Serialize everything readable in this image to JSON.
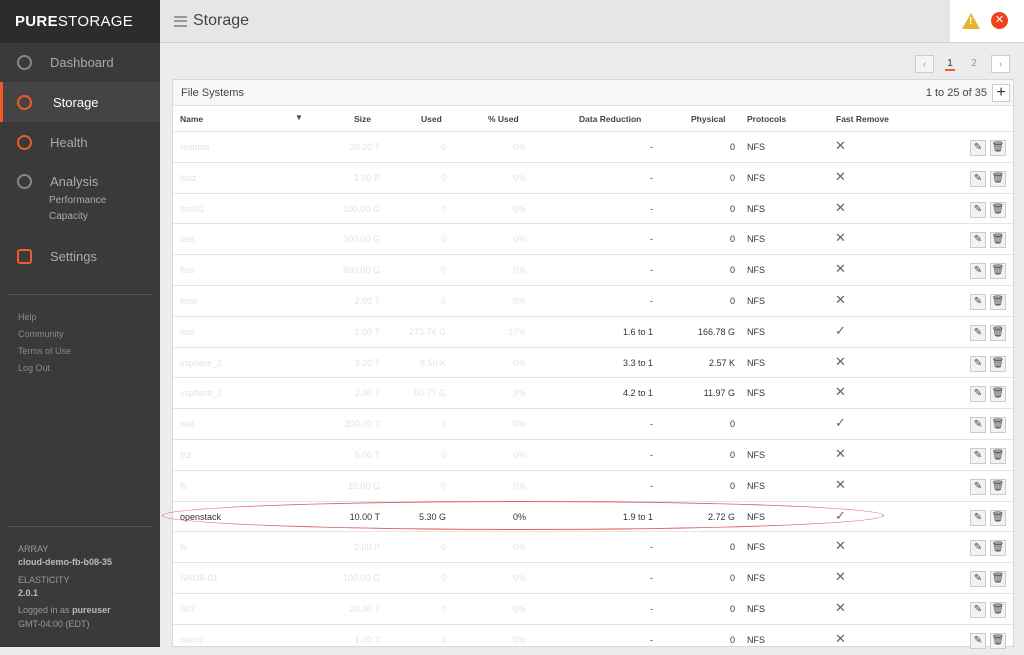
{
  "app": {
    "logo_bold": "PURE",
    "logo_light": "STORAGE",
    "page_title": "Storage"
  },
  "sidebar": {
    "items": [
      {
        "label": "Dashboard",
        "icon": "gauge-icon"
      },
      {
        "label": "Storage",
        "icon": "storage-icon",
        "active": true
      },
      {
        "label": "Health",
        "icon": "health-icon"
      },
      {
        "label": "Analysis",
        "icon": "analysis-icon"
      },
      {
        "label": "Settings",
        "icon": "settings-icon"
      }
    ],
    "analysis_sub": [
      "Performance",
      "Capacity"
    ],
    "links": [
      "Help",
      "Community",
      "Terms of Use",
      "Log Out"
    ],
    "array_label": "ARRAY",
    "array_name": "cloud-demo-fb-b08-35",
    "elasticity_label": "ELASTICITY",
    "elasticity_version": "2.0.1",
    "logged_prefix": "Logged in as",
    "user": "pureuser",
    "timezone": "GMT-04:00 (EDT)"
  },
  "alerts": {
    "warning_icon": "warning-icon",
    "error_icon": "error-icon"
  },
  "pagination": {
    "prev": "‹",
    "pages": [
      "1",
      "2"
    ],
    "current": "1",
    "next": "›"
  },
  "panel": {
    "title": "File Systems",
    "count": "1 to 25 of 35",
    "add": "+"
  },
  "columns": [
    "Name",
    "Size",
    "Used",
    "% Used",
    "Data Reduction",
    "Physical",
    "Protocols",
    "Fast Remove"
  ],
  "rows": [
    {
      "name": "resume",
      "size": "20.00 T",
      "used": "0",
      "pct": "0%",
      "dr": "-",
      "phys": "0",
      "proto": "NFS",
      "fast": false,
      "faint": true
    },
    {
      "name": "fsuz",
      "size": "1.00 P",
      "used": "0",
      "pct": "0%",
      "dr": "-",
      "phys": "0",
      "proto": "NFS",
      "fast": false,
      "faint": true
    },
    {
      "name": "test01",
      "size": "100.00 G",
      "used": "0",
      "pct": "0%",
      "dr": "-",
      "phys": "0",
      "proto": "NFS",
      "fast": false,
      "faint": true
    },
    {
      "name": "test",
      "size": "300.00 G",
      "used": "0",
      "pct": "0%",
      "dr": "-",
      "phys": "0",
      "proto": "NFS",
      "fast": false,
      "faint": true
    },
    {
      "name": "fsrs",
      "size": "600.00 G",
      "used": "0",
      "pct": "0%",
      "dr": "-",
      "phys": "0",
      "proto": "NFS",
      "fast": false,
      "faint": true
    },
    {
      "name": "fstat",
      "size": "2.00 T",
      "used": "0",
      "pct": "0%",
      "dr": "-",
      "phys": "0",
      "proto": "NFS",
      "fast": false,
      "faint": true
    },
    {
      "name": "test",
      "size": "1.00 T",
      "used": "273.74 G",
      "pct": "27%",
      "dr": "1.6 to 1",
      "phys": "166.78 G",
      "proto": "NFS",
      "fast": true,
      "faint": true
    },
    {
      "name": "vsphere_2",
      "size": "3.00 T",
      "used": "8.50 K",
      "pct": "0%",
      "dr": "3.3 to 1",
      "phys": "2.57 K",
      "proto": "NFS",
      "fast": false,
      "faint": true
    },
    {
      "name": "vsphere_1",
      "size": "2.00 T",
      "used": "50.77 G",
      "pct": "2%",
      "dr": "4.2 to 1",
      "phys": "11.97 G",
      "proto": "NFS",
      "fast": false,
      "faint": true
    },
    {
      "name": "test",
      "size": "300.00 T",
      "used": "0",
      "pct": "0%",
      "dr": "-",
      "phys": "0",
      "proto": "",
      "fast": true,
      "faint": true
    },
    {
      "name": "fsz",
      "size": "5.00 T",
      "used": "0",
      "pct": "0%",
      "dr": "-",
      "phys": "0",
      "proto": "NFS",
      "fast": false,
      "faint": true
    },
    {
      "name": "fs",
      "size": "10.00 G",
      "used": "0",
      "pct": "0%",
      "dr": "-",
      "phys": "0",
      "proto": "NFS",
      "fast": false,
      "faint": true
    },
    {
      "name": "openstack",
      "size": "10.00 T",
      "used": "5.30 G",
      "pct": "0%",
      "dr": "1.9 to 1",
      "phys": "2.72 G",
      "proto": "NFS",
      "fast": true,
      "faint": false
    },
    {
      "name": "fs",
      "size": "2.00 P",
      "used": "0",
      "pct": "0%",
      "dr": "-",
      "phys": "0",
      "proto": "NFS",
      "fast": false,
      "faint": true
    },
    {
      "name": "NADB-01",
      "size": "100.00 G",
      "used": "0",
      "pct": "0%",
      "dr": "-",
      "phys": "0",
      "proto": "NFS",
      "fast": false,
      "faint": true
    },
    {
      "name": "007",
      "size": "20.00 T",
      "used": "0",
      "pct": "0%",
      "dr": "-",
      "phys": "0",
      "proto": "NFS",
      "fast": false,
      "faint": true
    },
    {
      "name": "demo",
      "size": "1.00 T",
      "used": "0",
      "pct": "0%",
      "dr": "-",
      "phys": "0",
      "proto": "NFS",
      "fast": false,
      "faint": true
    }
  ],
  "marks": {
    "yes": "✓",
    "no": "✕",
    "edit": "✎",
    "delete": "🗑"
  },
  "colors": {
    "accent": "#f05a28",
    "sidebar": "#3a3a3a",
    "warning": "#e5b42c",
    "error": "#f0421c"
  }
}
